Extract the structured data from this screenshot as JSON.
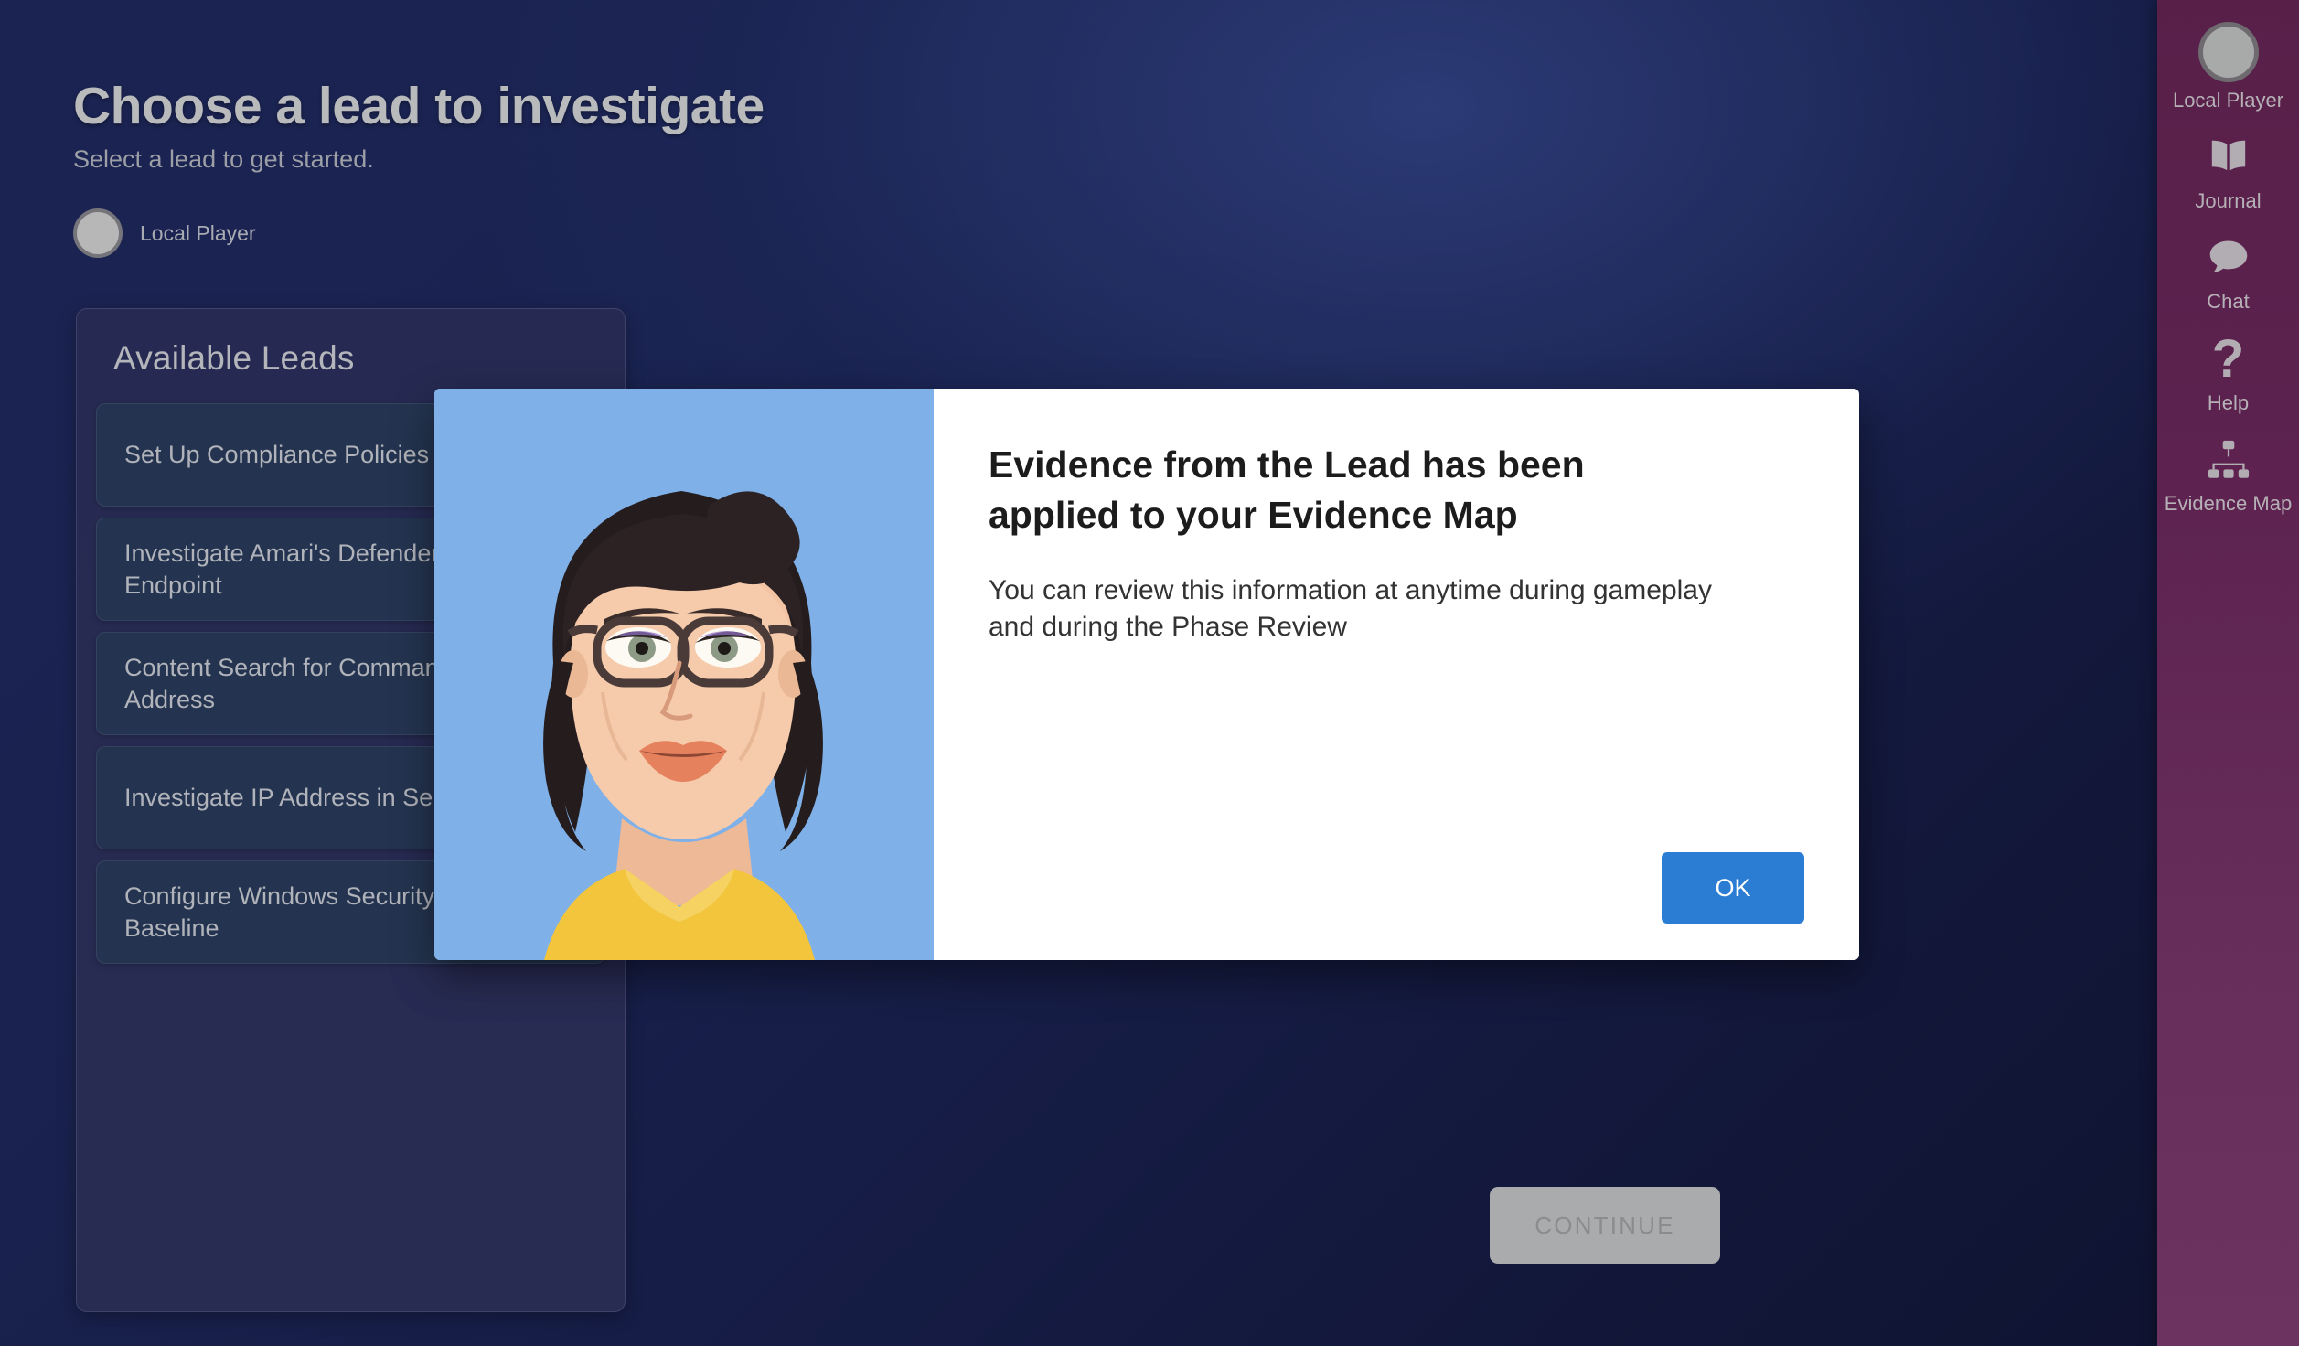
{
  "header": {
    "title": "Choose a lead to investigate",
    "subtitle": "Select a lead to get started."
  },
  "player": {
    "name": "Local Player",
    "avatar_icon": "avatar-circle-icon"
  },
  "leads_panel": {
    "heading": "Available Leads",
    "items": [
      {
        "title": "Set Up Compliance Policies",
        "completed": false
      },
      {
        "title": "Investigate Amari's Defender for Endpoint",
        "completed": false
      },
      {
        "title": "Content Search for Command & IP Address",
        "completed": false
      },
      {
        "title": "Investigate IP Address in Sentinel",
        "completed": true
      },
      {
        "title": "Configure Windows Security Baseline",
        "completed": true
      }
    ],
    "check_icon": "check-circle-icon",
    "check_color": "#3a7d37"
  },
  "continue": {
    "label": "CONTINUE",
    "disabled": true
  },
  "sidebar": {
    "items": [
      {
        "label": "Local Player",
        "icon": "avatar-circle-icon"
      },
      {
        "label": "Journal",
        "icon": "book-icon"
      },
      {
        "label": "Chat",
        "icon": "speech-bubble-icon"
      },
      {
        "label": "Help",
        "icon": "question-mark-icon"
      },
      {
        "label": "Evidence Map",
        "icon": "org-chart-icon"
      }
    ],
    "accent_color": "#5d2250"
  },
  "modal": {
    "title": "Evidence from the Lead has been applied to your Evidence Map",
    "message": "You can review this information at anytime during gameplay and during the Phase Review",
    "ok_label": "OK",
    "ok_color": "#2b7cd3",
    "portrait_alt": "character-portrait",
    "portrait_bg": "#7fb0e8"
  }
}
